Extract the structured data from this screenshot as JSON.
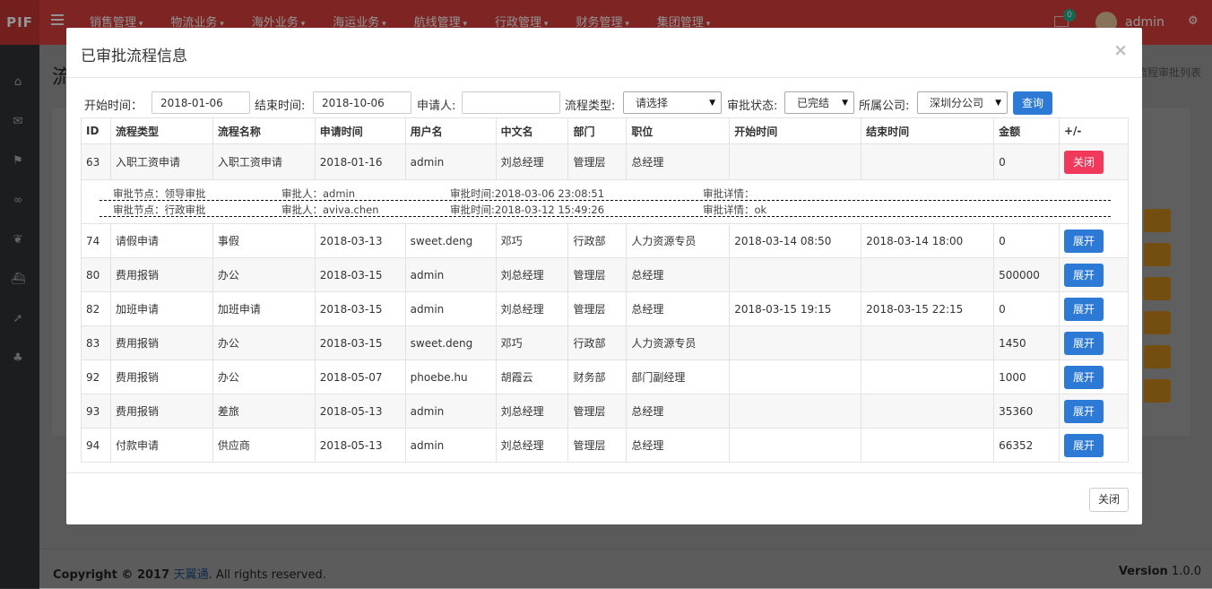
{
  "brand": "PIF",
  "nav": [
    "销售管理",
    "物流业务",
    "海外业务",
    "海运业务",
    "航线管理",
    "行政管理",
    "财务管理",
    "集团管理"
  ],
  "mail_badge": "0",
  "username": "admin",
  "page": {
    "title": "流",
    "breadcrumb": "流程审批列表"
  },
  "footer": {
    "copyright_prefix": "Copyright © 2017 ",
    "company": "天翼通",
    "copyright_suffix": ". All rights reserved.",
    "version_label": "Version",
    "version": "1.0.0"
  },
  "modal": {
    "title": "已审批流程信息",
    "close_x": "×",
    "footer_close": "关闭",
    "filters": {
      "start_label": "开始时间：",
      "start_value": "2018-01-06",
      "end_label": "结束时间:",
      "end_value": "2018-10-06",
      "applicant_label": "申请人:",
      "applicant_value": "",
      "type_label": "流程类型:",
      "type_value": "请选择",
      "status_label": "审批状态:",
      "status_value": "已完结",
      "company_label": "所属公司:",
      "company_value": "深圳分公司",
      "query_label": "查询"
    },
    "table": {
      "headers": [
        "ID",
        "流程类型",
        "流程名称",
        "申请时间",
        "用户名",
        "中文名",
        "部门",
        "职位",
        "开始时间",
        "结束时间",
        "金额",
        "+/-"
      ],
      "rows": [
        [
          "63",
          "入职工资申请",
          "入职工资申请",
          "2018-01-16",
          "admin",
          "刘总经理",
          "管理层",
          "总经理",
          "",
          "",
          "0",
          "关闭"
        ],
        [
          "74",
          "请假申请",
          "事假",
          "2018-03-13",
          "sweet.deng",
          "邓巧",
          "行政部",
          "人力资源专员",
          "2018-03-14 08:50",
          "2018-03-14 18:00",
          "0",
          "展开"
        ],
        [
          "80",
          "费用报销",
          "办公",
          "2018-03-15",
          "admin",
          "刘总经理",
          "管理层",
          "总经理",
          "",
          "",
          "500000",
          "展开"
        ],
        [
          "82",
          "加班申请",
          "加班申请",
          "2018-03-15",
          "admin",
          "刘总经理",
          "管理层",
          "总经理",
          "2018-03-15 19:15",
          "2018-03-15 22:15",
          "0",
          "展开"
        ],
        [
          "83",
          "费用报销",
          "办公",
          "2018-03-15",
          "sweet.deng",
          "邓巧",
          "行政部",
          "人力资源专员",
          "",
          "",
          "1450",
          "展开"
        ],
        [
          "92",
          "费用报销",
          "办公",
          "2018-05-07",
          "phoebe.hu",
          "胡霞云",
          "财务部",
          "部门副经理",
          "",
          "",
          "1000",
          "展开"
        ],
        [
          "93",
          "费用报销",
          "差旅",
          "2018-05-13",
          "admin",
          "刘总经理",
          "管理层",
          "总经理",
          "",
          "",
          "35360",
          "展开"
        ],
        [
          "94",
          "付款申请",
          "供应商",
          "2018-05-13",
          "admin",
          "刘总经理",
          "管理层",
          "总经理",
          "",
          "",
          "66352",
          "展开"
        ]
      ],
      "details": [
        {
          "node": "审批节点：领导审批",
          "approver": "审批人：admin",
          "time": "审批时间:2018-03-06 23:08:51",
          "detail": "审批详情："
        },
        {
          "node": "审批节点：行政审批",
          "approver": "审批人：aviva.chen",
          "time": "审批时间:2018-03-12 15:49:26",
          "detail": "审批详情：ok"
        }
      ]
    }
  }
}
